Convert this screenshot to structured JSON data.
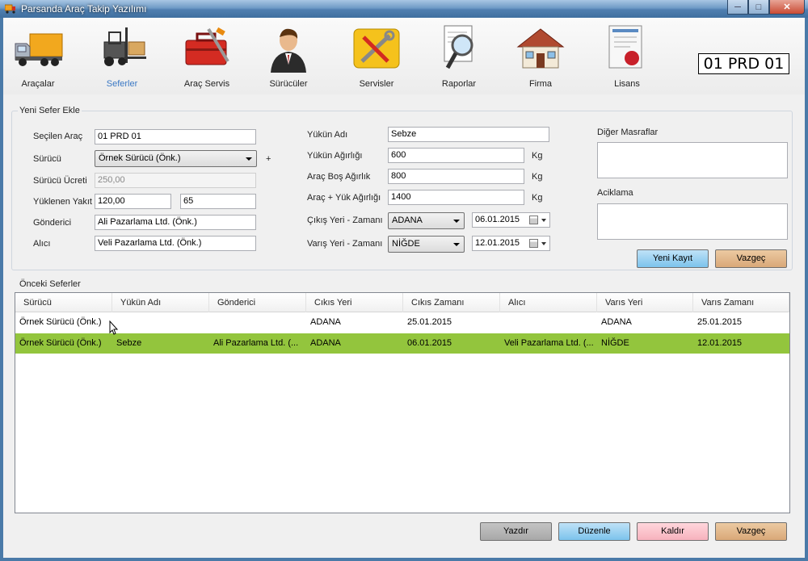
{
  "window": {
    "title": "Parsanda Araç Takip Yazılımı",
    "controls": {
      "minimize": "─",
      "maximize": "□",
      "close": "✕"
    }
  },
  "toolbar": {
    "items": [
      {
        "label": "Araçalar",
        "icon": "truck-icon"
      },
      {
        "label": "Seferler",
        "icon": "forklift-icon",
        "active": true
      },
      {
        "label": "Araç Servis",
        "icon": "toolbox-icon"
      },
      {
        "label": "Sürücüler",
        "icon": "driver-icon"
      },
      {
        "label": "Servisler",
        "icon": "service-tools-icon"
      },
      {
        "label": "Raporlar",
        "icon": "report-magnifier-icon"
      },
      {
        "label": "Firma",
        "icon": "house-icon"
      },
      {
        "label": "Lisans",
        "icon": "certificate-icon"
      }
    ],
    "plate": "01 PRD 01"
  },
  "form": {
    "group_title": "Yeni Sefer Ekle",
    "secilen_arac": {
      "label": "Seçilen Araç",
      "value": "01 PRD 01"
    },
    "surucu": {
      "label": "Sürücü",
      "value": "Örnek Sürücü  (Önk.)",
      "add": "+"
    },
    "surucu_ucreti": {
      "label": "Sürücü Ücreti",
      "value": "250,00"
    },
    "yuklenen_yakit": {
      "label": "Yüklenen Yakıt",
      "value1": "120,00",
      "value2": "65"
    },
    "gonderici": {
      "label": "Gönderici",
      "value": "Ali Pazarlama Ltd. (Önk.)"
    },
    "alici": {
      "label": "Alıcı",
      "value": "Veli Pazarlama Ltd. (Önk.)"
    },
    "yukun_adi": {
      "label": "Yükün Adı",
      "value": "Sebze"
    },
    "yukun_agirligi": {
      "label": "Yükün Ağırlığı",
      "value": "600",
      "unit": "Kg"
    },
    "arac_bos_agirlik": {
      "label": "Araç Boş Ağırlık",
      "value": "800",
      "unit": "Kg"
    },
    "arac_yuk_agirligi": {
      "label": "Araç + Yük Ağırlığı",
      "value": "1400",
      "unit": "Kg"
    },
    "cikis": {
      "label": "Çıkış Yeri - Zamanı",
      "place": "ADANA",
      "date": "06.01.2015"
    },
    "varis": {
      "label": "Varış Yeri - Zamanı",
      "place": "NİĞDE",
      "date": "12.01.2015"
    },
    "diger_masraflar": {
      "label": "Diğer Masraflar",
      "value": ""
    },
    "aciklama": {
      "label": "Aciklama",
      "value": ""
    },
    "buttons": {
      "new": "Yeni Kayıt",
      "cancel": "Vazgeç"
    }
  },
  "grid": {
    "group_title": "Önceki Seferler",
    "columns": [
      "Sürücü",
      "Yükün Adı",
      "Gönderici",
      "Cıkıs Yeri",
      "Cıkıs Zamanı",
      "Alıcı",
      "Varıs Yeri",
      "Varıs Zamanı"
    ],
    "rows": [
      [
        "Örnek Sürücü  (Önk.)",
        "",
        "",
        "ADANA",
        "25.01.2015",
        "",
        "ADANA",
        "25.01.2015"
      ],
      [
        "Örnek Sürücü  (Önk.)",
        "Sebze",
        "Ali Pazarlama Ltd. (...",
        "ADANA",
        "06.01.2015",
        "Veli Pazarlama Ltd. (...",
        "NİĞDE",
        "12.01.2015"
      ]
    ],
    "selected_row": 1
  },
  "bottom_buttons": {
    "print": "Yazdır",
    "edit": "Düzenle",
    "remove": "Kaldır",
    "cancel": "Vazgeç"
  },
  "colors": {
    "selected_row": "#93c53d",
    "accent_label": "#3a78c4"
  }
}
